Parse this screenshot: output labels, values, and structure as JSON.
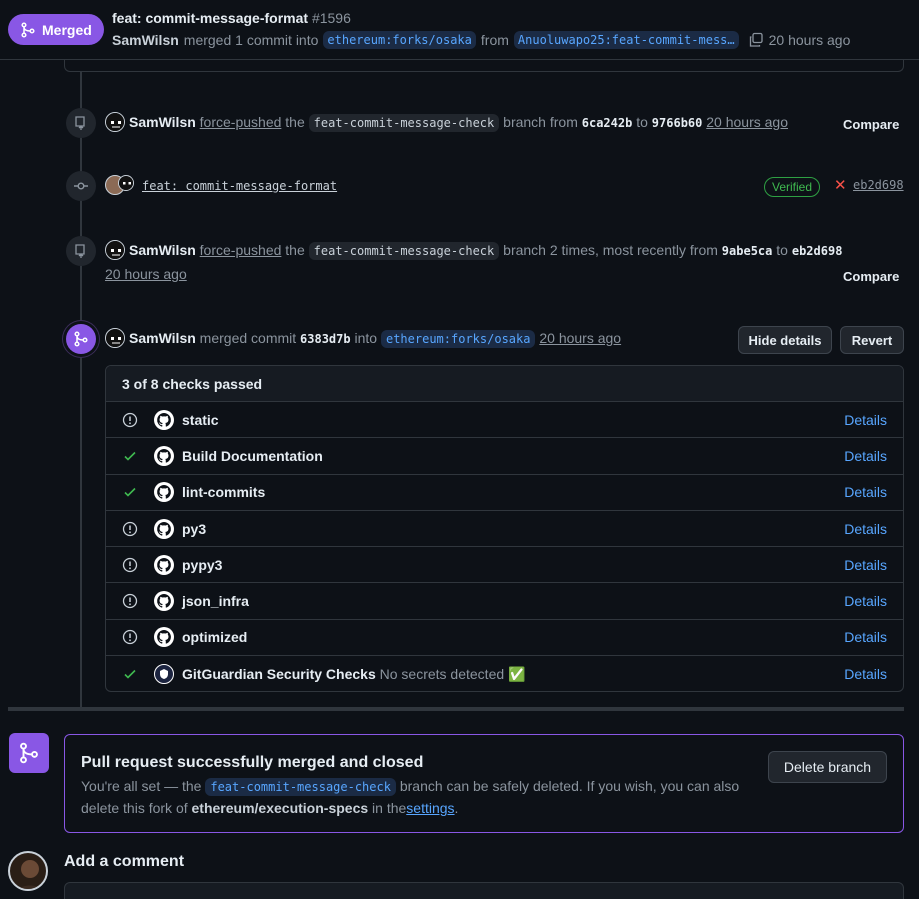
{
  "header": {
    "state_label": "Merged",
    "title": "feat: commit-message-format",
    "number": "#1596",
    "author": "SamWilsn",
    "merged_text": "merged 1 commit into",
    "base_branch": "ethereum:forks/osaka",
    "from_text": "from",
    "head_branch": "Anuoluwapo25:feat-commit-mess…",
    "time": "20 hours ago"
  },
  "events": [
    {
      "user": "SamWilsn",
      "action": "force-pushed",
      "the": "the",
      "branch": "feat-commit-message-check",
      "branch_text": "branch from",
      "from_sha": "6ca242b",
      "to": "to",
      "to_sha": "9766b60",
      "time": "20 hours ago",
      "compare": "Compare"
    },
    {
      "commit_message": "feat: commit-message-format",
      "verified": "Verified",
      "x_mark": "✕",
      "sha": "eb2d698"
    },
    {
      "user": "SamWilsn",
      "action": "force-pushed",
      "the": "the",
      "branch": "feat-commit-message-check",
      "branch_text": "branch 2 times, most recently from",
      "from_sha": "9abe5ca",
      "to": "to",
      "to_sha": "eb2d698",
      "time": "20 hours ago",
      "compare": "Compare"
    },
    {
      "user": "SamWilsn",
      "merged_commit": "merged commit",
      "sha": "6383d7b",
      "into": "into",
      "branch": "ethereum:forks/osaka",
      "time": "20 hours ago",
      "hide_details": "Hide details",
      "revert": "Revert"
    }
  ],
  "checks": {
    "summary": "3 of 8 checks passed",
    "details_label": "Details",
    "rows": [
      {
        "status": "neutral",
        "name": "static",
        "desc": ""
      },
      {
        "status": "success",
        "name": "Build Documentation",
        "desc": ""
      },
      {
        "status": "success",
        "name": "lint-commits",
        "desc": ""
      },
      {
        "status": "neutral",
        "name": "py3",
        "desc": ""
      },
      {
        "status": "neutral",
        "name": "pypy3",
        "desc": ""
      },
      {
        "status": "neutral",
        "name": "json_infra",
        "desc": ""
      },
      {
        "status": "neutral",
        "name": "optimized",
        "desc": ""
      },
      {
        "status": "success",
        "name": "GitGuardian Security Checks",
        "desc": "No secrets detected ✅"
      }
    ]
  },
  "merge_box": {
    "title": "Pull request successfully merged and closed",
    "desc_1": "You're all set — the",
    "branch": "feat-commit-message-check",
    "desc_2": "branch can be safely deleted. If you wish, you can also delete this fork of",
    "repo": "ethereum/execution-specs",
    "desc_3": "in the",
    "settings": "settings",
    "period": ".",
    "delete_button": "Delete branch"
  },
  "comment": {
    "title": "Add a comment"
  },
  "colors": {
    "merged": "#8957e5",
    "link": "#58a6ff",
    "success": "#3fb950",
    "danger": "#f85149",
    "bg": "#0d1117"
  }
}
